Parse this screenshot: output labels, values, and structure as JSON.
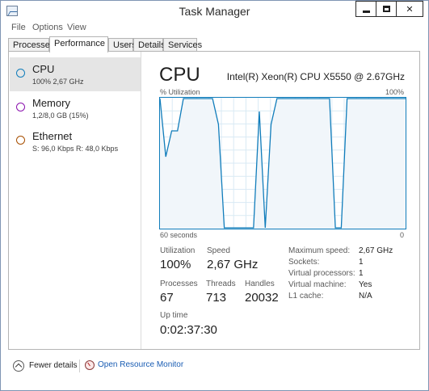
{
  "window": {
    "title": "Task Manager",
    "min_symbol": "",
    "close_symbol": "✕"
  },
  "menu": {
    "items": [
      "File",
      "Options",
      "View"
    ]
  },
  "tabs": [
    {
      "label": "Processes",
      "active": false
    },
    {
      "label": "Performance",
      "active": true
    },
    {
      "label": "Users",
      "active": false
    },
    {
      "label": "Details",
      "active": false
    },
    {
      "label": "Services",
      "active": false
    }
  ],
  "sidebar": {
    "items": [
      {
        "title": "CPU",
        "subtitle": "100% 2,67 GHz",
        "color": "#117dbb",
        "active": true
      },
      {
        "title": "Memory",
        "subtitle": "1,2/8,0 GB (15%)",
        "color": "#8b12ae",
        "active": false
      },
      {
        "title": "Ethernet",
        "subtitle": "S: 96,0 Kbps R: 48,0 Kbps",
        "color": "#a74f01",
        "active": false
      }
    ]
  },
  "main": {
    "title": "CPU",
    "cpu_model": "Intel(R) Xeon(R) CPU X5550 @ 2.67GHz",
    "graph": {
      "top_left_label": "% Utilization",
      "top_right_label": "100%",
      "bottom_left_label": "60 seconds",
      "bottom_right_label": "0",
      "line_color": "#117dbb",
      "fill_color": "#f1f6fa",
      "grid_color": "#d9eaf4",
      "utilization_series": [
        100,
        55,
        75,
        75,
        100,
        100,
        100,
        100,
        100,
        100,
        80,
        0,
        0,
        0,
        0,
        0,
        0,
        90,
        0,
        80,
        100,
        100,
        100,
        100,
        100,
        100,
        100,
        100,
        100,
        100,
        0,
        0,
        100,
        100,
        100,
        100,
        100,
        100,
        100,
        100,
        100,
        100,
        100
      ]
    },
    "stats": {
      "utilization_label": "Utilization",
      "utilization_value": "100%",
      "speed_label": "Speed",
      "speed_value": "2,67 GHz",
      "processes_label": "Processes",
      "processes_value": "67",
      "threads_label": "Threads",
      "threads_value": "713",
      "handles_label": "Handles",
      "handles_value": "20032",
      "uptime_label": "Up time",
      "uptime_value": "0:02:37:30"
    },
    "info": [
      {
        "label": "Maximum speed:",
        "value": "2,67 GHz"
      },
      {
        "label": "Sockets:",
        "value": "1"
      },
      {
        "label": "Virtual processors:",
        "value": "1"
      },
      {
        "label": "Virtual machine:",
        "value": "Yes"
      },
      {
        "label": "L1 cache:",
        "value": "N/A"
      }
    ]
  },
  "footer": {
    "fewer_details": "Fewer details",
    "open_resource_monitor": "Open Resource Monitor"
  }
}
